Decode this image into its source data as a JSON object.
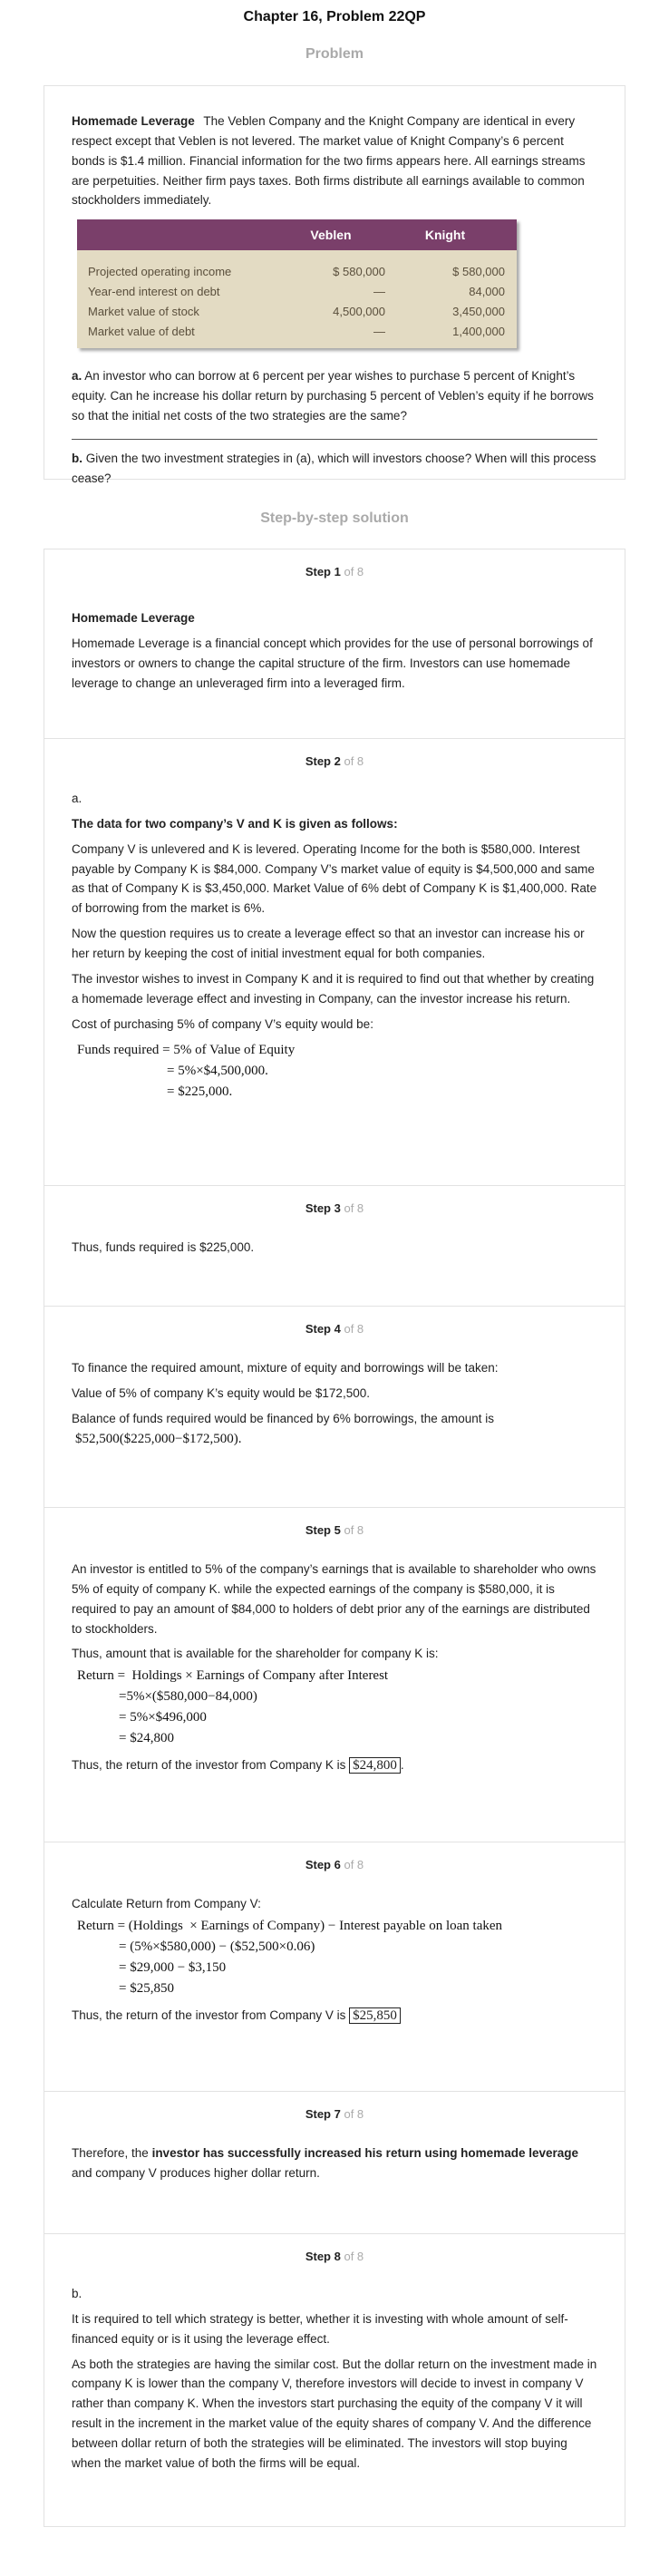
{
  "header": {
    "title": "Chapter 16, Problem 22QP",
    "problem_label": "Problem",
    "solution_label": "Step-by-step solution"
  },
  "problem": {
    "heading": "Homemade Leverage",
    "text": "The Veblen Company and the Knight Company are identical in every respect except that Veblen is not levered. The market value of Knight Company’s 6 percent bonds is $1.4 million. Financial information for the two firms appears here. All earnings streams are perpetuities. Neither firm pays taxes. Both firms distribute all earnings available to common stockholders immediately.",
    "table": {
      "columns": [
        "",
        "Veblen",
        "Knight"
      ],
      "rows": [
        [
          "Projected operating income",
          "$  580,000",
          "$  580,000"
        ],
        [
          "Year-end interest on debt",
          "—",
          "84,000"
        ],
        [
          "Market value of stock",
          "4,500,000",
          "3,450,000"
        ],
        [
          "Market value of debt",
          "—",
          "1,400,000"
        ]
      ]
    },
    "qa_label": "a.",
    "qa_text": "An investor who can borrow at 6 percent per year wishes to purchase 5 percent of Knight’s equity. Can he increase his dollar return by purchasing 5 percent of Veblen’s equity if he borrows so that the initial net costs of the two strategies are the same?",
    "qb_label": "b.",
    "qb_text": "Given the two investment strategies in (a), which will investors choose? When will this process cease?"
  },
  "steps": {
    "of_total": "of 8",
    "s1": {
      "num": "Step 1",
      "heading": "Homemade Leverage",
      "text": "Homemade Leverage is a financial concept which provides for the use of personal borrowings of investors or owners to change the capital structure of the firm. Investors can use homemade leverage to change an unleveraged firm into a leveraged firm."
    },
    "s2": {
      "num": "Step 2",
      "part": "a.",
      "heading": "The data for two company’s V and K is given as follows:",
      "p1": "Company V is unlevered and K is levered. Operating Income for the both is $580,000. Interest payable by Company K is $84,000. Company V’s market value of equity is $4,500,000 and same as that of Company K is $3,450,000. Market Value of 6% debt of Company K is $1,400,000. Rate of borrowing from the market is 6%.",
      "p2": "Now the question requires us to create a leverage effect so that an investor can increase his or her return by keeping the cost of initial investment equal for both companies.",
      "p3": "The investor wishes to invest in Company K and it is required to find out that whether by creating a homemade leverage effect and investing in Company, can the investor increase his return.",
      "p4": "Cost of purchasing 5% of company V’s equity would be:",
      "m1": "Funds required = 5% of Value of Equity",
      "m2": "= 5%×$4,500,000.",
      "m3": "= $225,000."
    },
    "s3": {
      "num": "Step 3",
      "text": "Thus, funds required is $225,000."
    },
    "s4": {
      "num": "Step 4",
      "p1": "To finance the required amount, mixture of equity and borrowings will be taken:",
      "p2": "Value of 5% of company K’s equity would be $172,500.",
      "p3": "Balance of funds required would be financed by 6% borrowings, the amount is",
      "m1": "$52,500($225,000−$172,500)."
    },
    "s5": {
      "num": "Step 5",
      "p1": "An investor is entitled to 5% of the company’s earnings that is available to shareholder who owns 5% of equity of company K. while the expected earnings of the company is $580,000, it is required to pay an amount of $84,000 to holders of debt prior any of the earnings are distributed to stockholders.",
      "p2": "Thus, amount that is available for the shareholder for company K is:",
      "m1": "Return =  Holdings × Earnings of Company after Interest",
      "m2": "=5%×($580,000−84,000)",
      "m3": "= 5%×$496,000",
      "m4": "= $24,800",
      "conclusion": "Thus, the return of the investor from Company K is",
      "answer": "$24,800"
    },
    "s6": {
      "num": "Step 6",
      "p1": "Calculate Return from Company V:",
      "m1": "Return = (Holdings  × Earnings of Company) − Interest payable on loan taken",
      "m2": "= (5%×$580,000) − ($52,500×0.06)",
      "m3": "= $29,000 − $3,150",
      "m4": "= $25,850",
      "conclusion": "Thus, the return of the investor from Company V is",
      "answer": "$25,850"
    },
    "s7": {
      "num": "Step 7",
      "t1": "Therefore, the",
      "t2": "investor has successfully increased his return using homemade leverage",
      "t3": "and company V produces higher dollar return."
    },
    "s8": {
      "num": "Step 8",
      "part": "b.",
      "p1": "It is required to tell which strategy is better, whether it is investing with whole amount of self-financed equity or is it using the leverage effect.",
      "p2": "As both the strategies are having the similar cost. But the dollar return on the investment made in company K is lower than the company V, therefore investors will decide to invest in company V rather than company K. When the investors start purchasing the equity of the company V it will result in the increment in the market value of the equity shares of company V. And the difference between dollar return of both the strategies will be eliminated. The investors will stop buying when the market value of both the firms will be equal."
    }
  }
}
